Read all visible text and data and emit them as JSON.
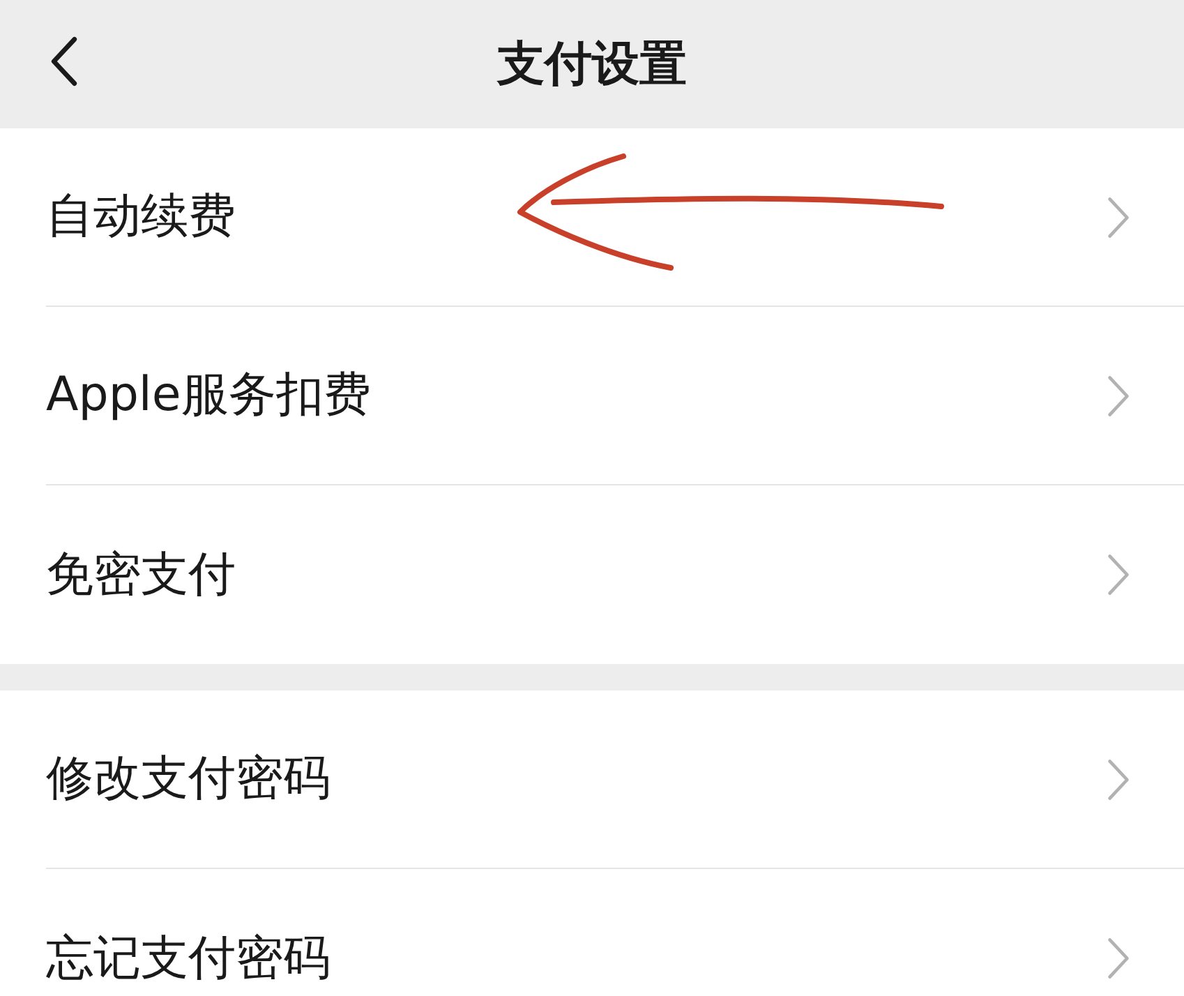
{
  "title": "支付设置",
  "groups": [
    {
      "items": [
        {
          "label": "自动续费",
          "annotated": true
        },
        {
          "label": "Apple服务扣费",
          "annotated": false
        },
        {
          "label": "免密支付",
          "annotated": false
        }
      ]
    },
    {
      "items": [
        {
          "label": "修改支付密码",
          "annotated": false
        },
        {
          "label": "忘记支付密码",
          "annotated": false
        }
      ]
    }
  ]
}
